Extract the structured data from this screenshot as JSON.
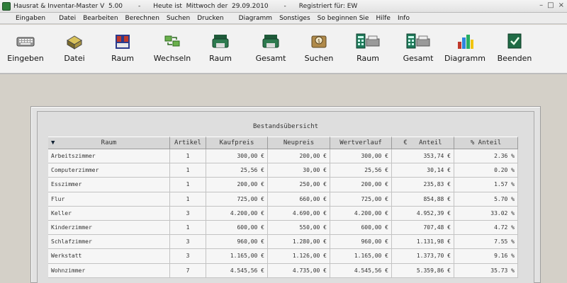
{
  "titlebar": {
    "app_title": "Hausrat & Inventar-Master V  5.00",
    "separator1": "-",
    "today_text": "Heute ist  Mittwoch der  29.09.2010",
    "separator2": "-",
    "registered_text": "Registriert für: EW"
  },
  "menu": [
    "Eingaben",
    "Datei",
    "Bearbeiten",
    "Berechnen",
    "Suchen",
    "Drucken",
    "Diagramm",
    "Sonstiges",
    "So beginnen Sie",
    "Hilfe",
    "Info"
  ],
  "toolbar": [
    {
      "label": "Eingeben",
      "icon": "keyboard-icon"
    },
    {
      "label": "Datei",
      "icon": "file-box-icon"
    },
    {
      "label": "Raum",
      "icon": "room-icon"
    },
    {
      "label": "Wechseln",
      "icon": "switch-icon"
    },
    {
      "label": "Raum",
      "icon": "printer-icon"
    },
    {
      "label": "Gesamt",
      "icon": "printer-icon"
    },
    {
      "label": "Suchen",
      "icon": "search-icon"
    },
    {
      "label": "Raum",
      "icon": "calculator-icon"
    },
    {
      "label": "Gesamt",
      "icon": "calculator-icon"
    },
    {
      "label": "Diagramm",
      "icon": "bar-chart-icon"
    },
    {
      "label": "Beenden",
      "icon": "exit-icon"
    }
  ],
  "panel": {
    "title": "Bestandsübersicht"
  },
  "table": {
    "sort_indicator": "▼",
    "columns": [
      "Raum",
      "Artikel",
      "Kaufpreis",
      "Neupreis",
      "Wertverlauf",
      "€   Anteil",
      "% Anteil"
    ],
    "rows": [
      [
        "Arbeitszimmer",
        "1",
        "300,00 €",
        "200,00 €",
        "300,00 €",
        "353,74 €",
        "2.36 %"
      ],
      [
        "Computerzimmer",
        "1",
        "25,56 €",
        "30,00 €",
        "25,56 €",
        "30,14 €",
        "0.20 %"
      ],
      [
        "Esszimmer",
        "1",
        "200,00 €",
        "250,00 €",
        "200,00 €",
        "235,83 €",
        "1.57 %"
      ],
      [
        "Flur",
        "1",
        "725,00 €",
        "660,00 €",
        "725,00 €",
        "854,88 €",
        "5.70 %"
      ],
      [
        "Keller",
        "3",
        "4.200,00 €",
        "4.690,00 €",
        "4.200,00 €",
        "4.952,39 €",
        "33.02 %"
      ],
      [
        "Kinderzimmer",
        "1",
        "600,00 €",
        "550,00 €",
        "600,00 €",
        "707,48 €",
        "4.72 %"
      ],
      [
        "Schlafzimmer",
        "3",
        "960,00 €",
        "1.280,00 €",
        "960,00 €",
        "1.131,98 €",
        "7.55 %"
      ],
      [
        "Werkstatt",
        "3",
        "1.165,00 €",
        "1.126,00 €",
        "1.165,00 €",
        "1.373,70 €",
        "9.16 %"
      ],
      [
        "Wohnzimmer",
        "7",
        "4.545,56 €",
        "4.735,00 €",
        "4.545,56 €",
        "5.359,86 €",
        "35.73 %"
      ]
    ]
  }
}
